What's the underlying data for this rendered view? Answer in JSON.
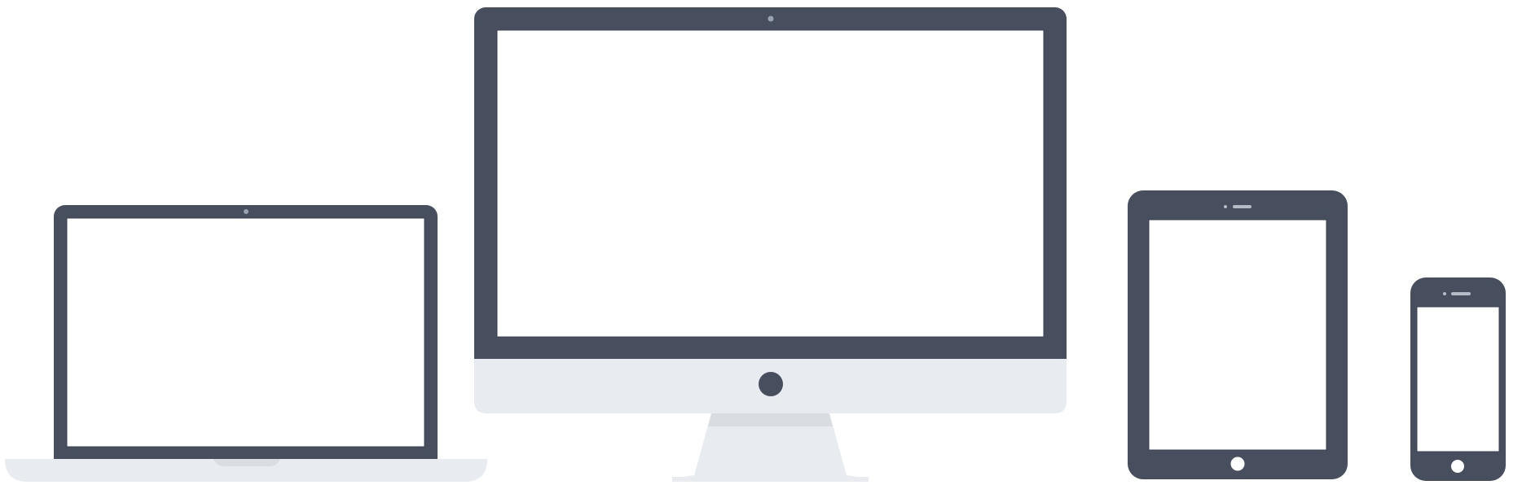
{
  "colors": {
    "background": "#ffffff",
    "bezel": "#474f5f",
    "screen": "#ffffff",
    "base": "#e8ebef",
    "base_shade": "#d9dce1",
    "camera": "#9aa3b0",
    "speaker": "#b5bcc6"
  },
  "devices": [
    {
      "name": "laptop",
      "screen_text": ""
    },
    {
      "name": "desktop-monitor",
      "screen_text": ""
    },
    {
      "name": "tablet",
      "screen_text": ""
    },
    {
      "name": "phone",
      "screen_text": ""
    }
  ]
}
